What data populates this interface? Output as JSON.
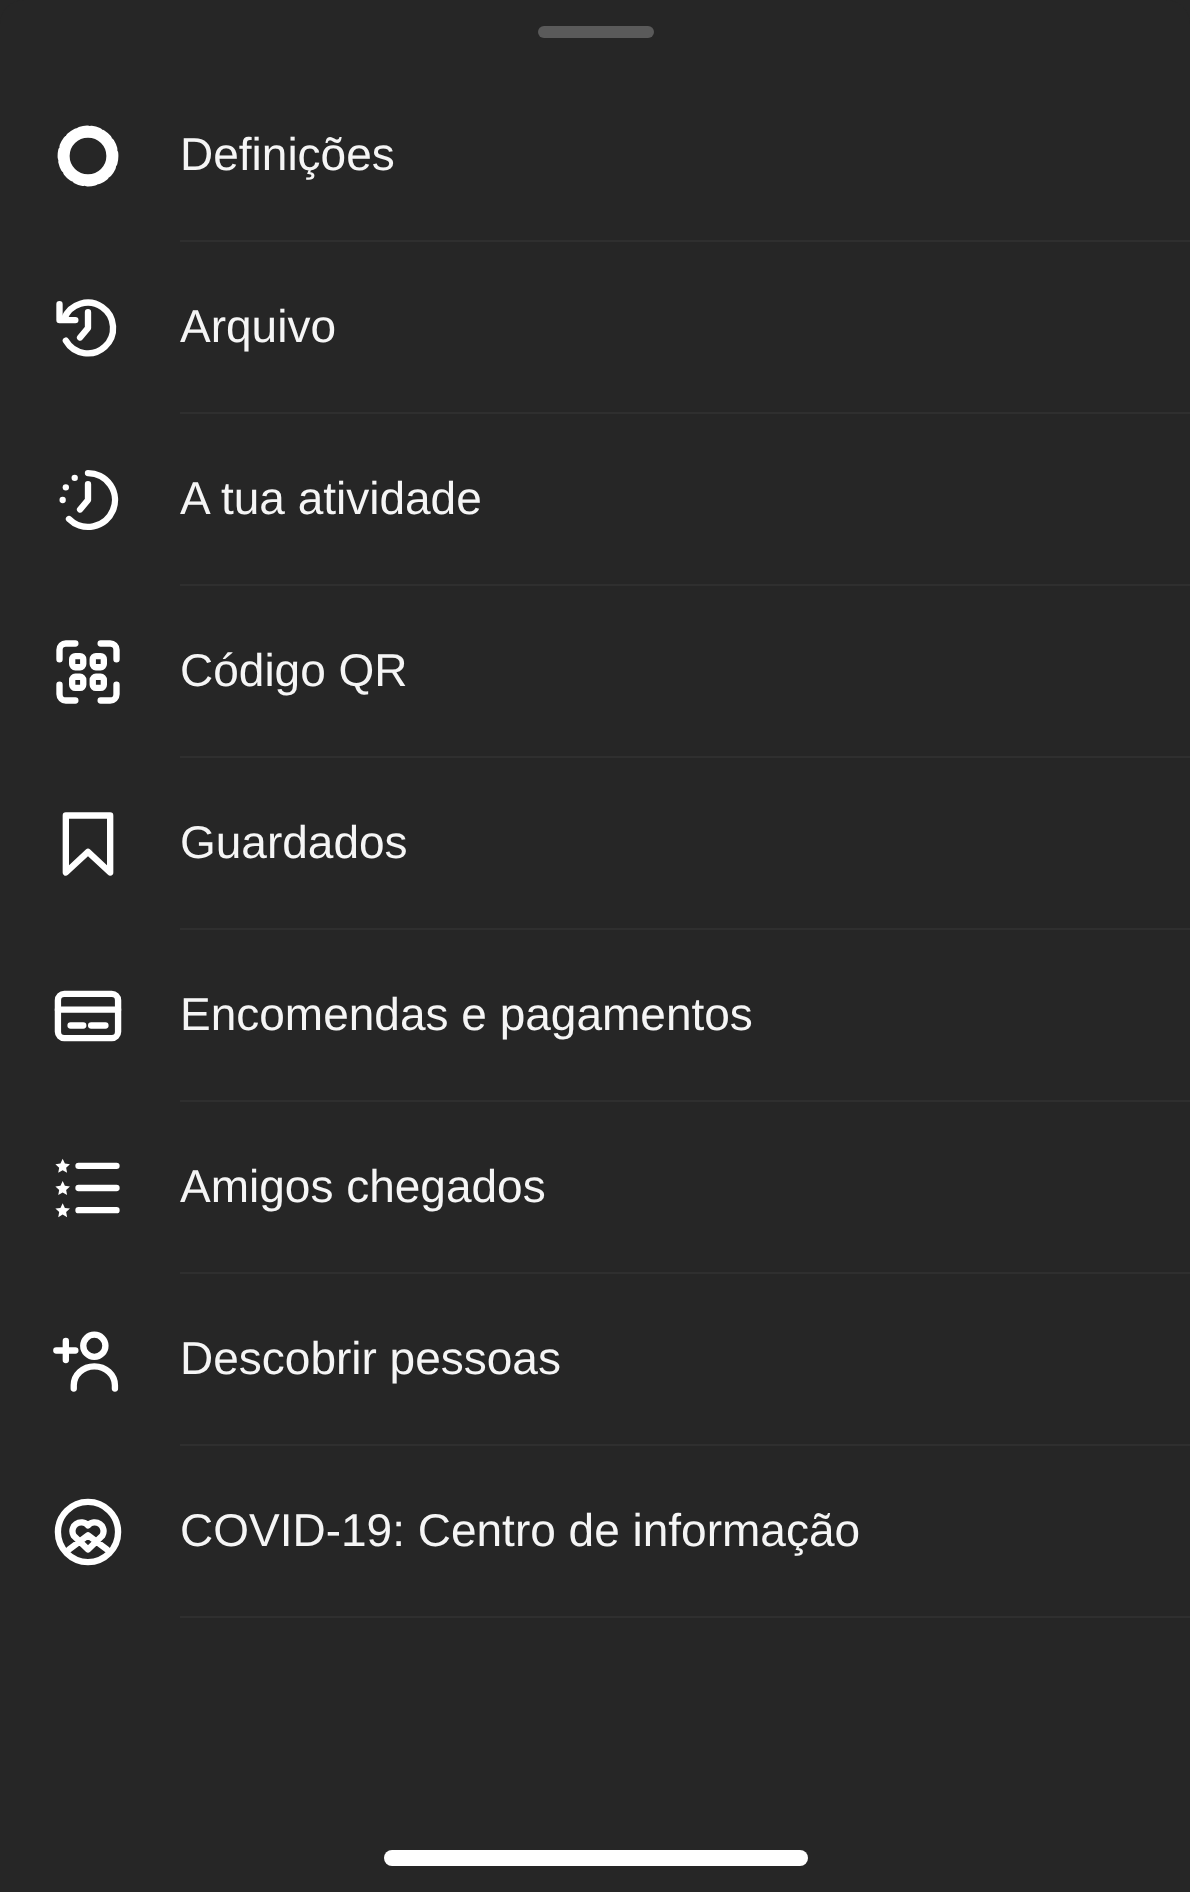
{
  "menu": [
    {
      "kind": "settings",
      "label": "Definições"
    },
    {
      "kind": "archive",
      "label": "Arquivo"
    },
    {
      "kind": "activity",
      "label": "A tua atividade"
    },
    {
      "kind": "qr",
      "label": "Código QR"
    },
    {
      "kind": "saved",
      "label": "Guardados"
    },
    {
      "kind": "card",
      "label": "Encomendas e pagamentos"
    },
    {
      "kind": "close-friends",
      "label": "Amigos chegados"
    },
    {
      "kind": "add-person",
      "label": "Descobrir pessoas"
    },
    {
      "kind": "heart-circle",
      "label": "COVID-19: Centro de informação"
    }
  ]
}
